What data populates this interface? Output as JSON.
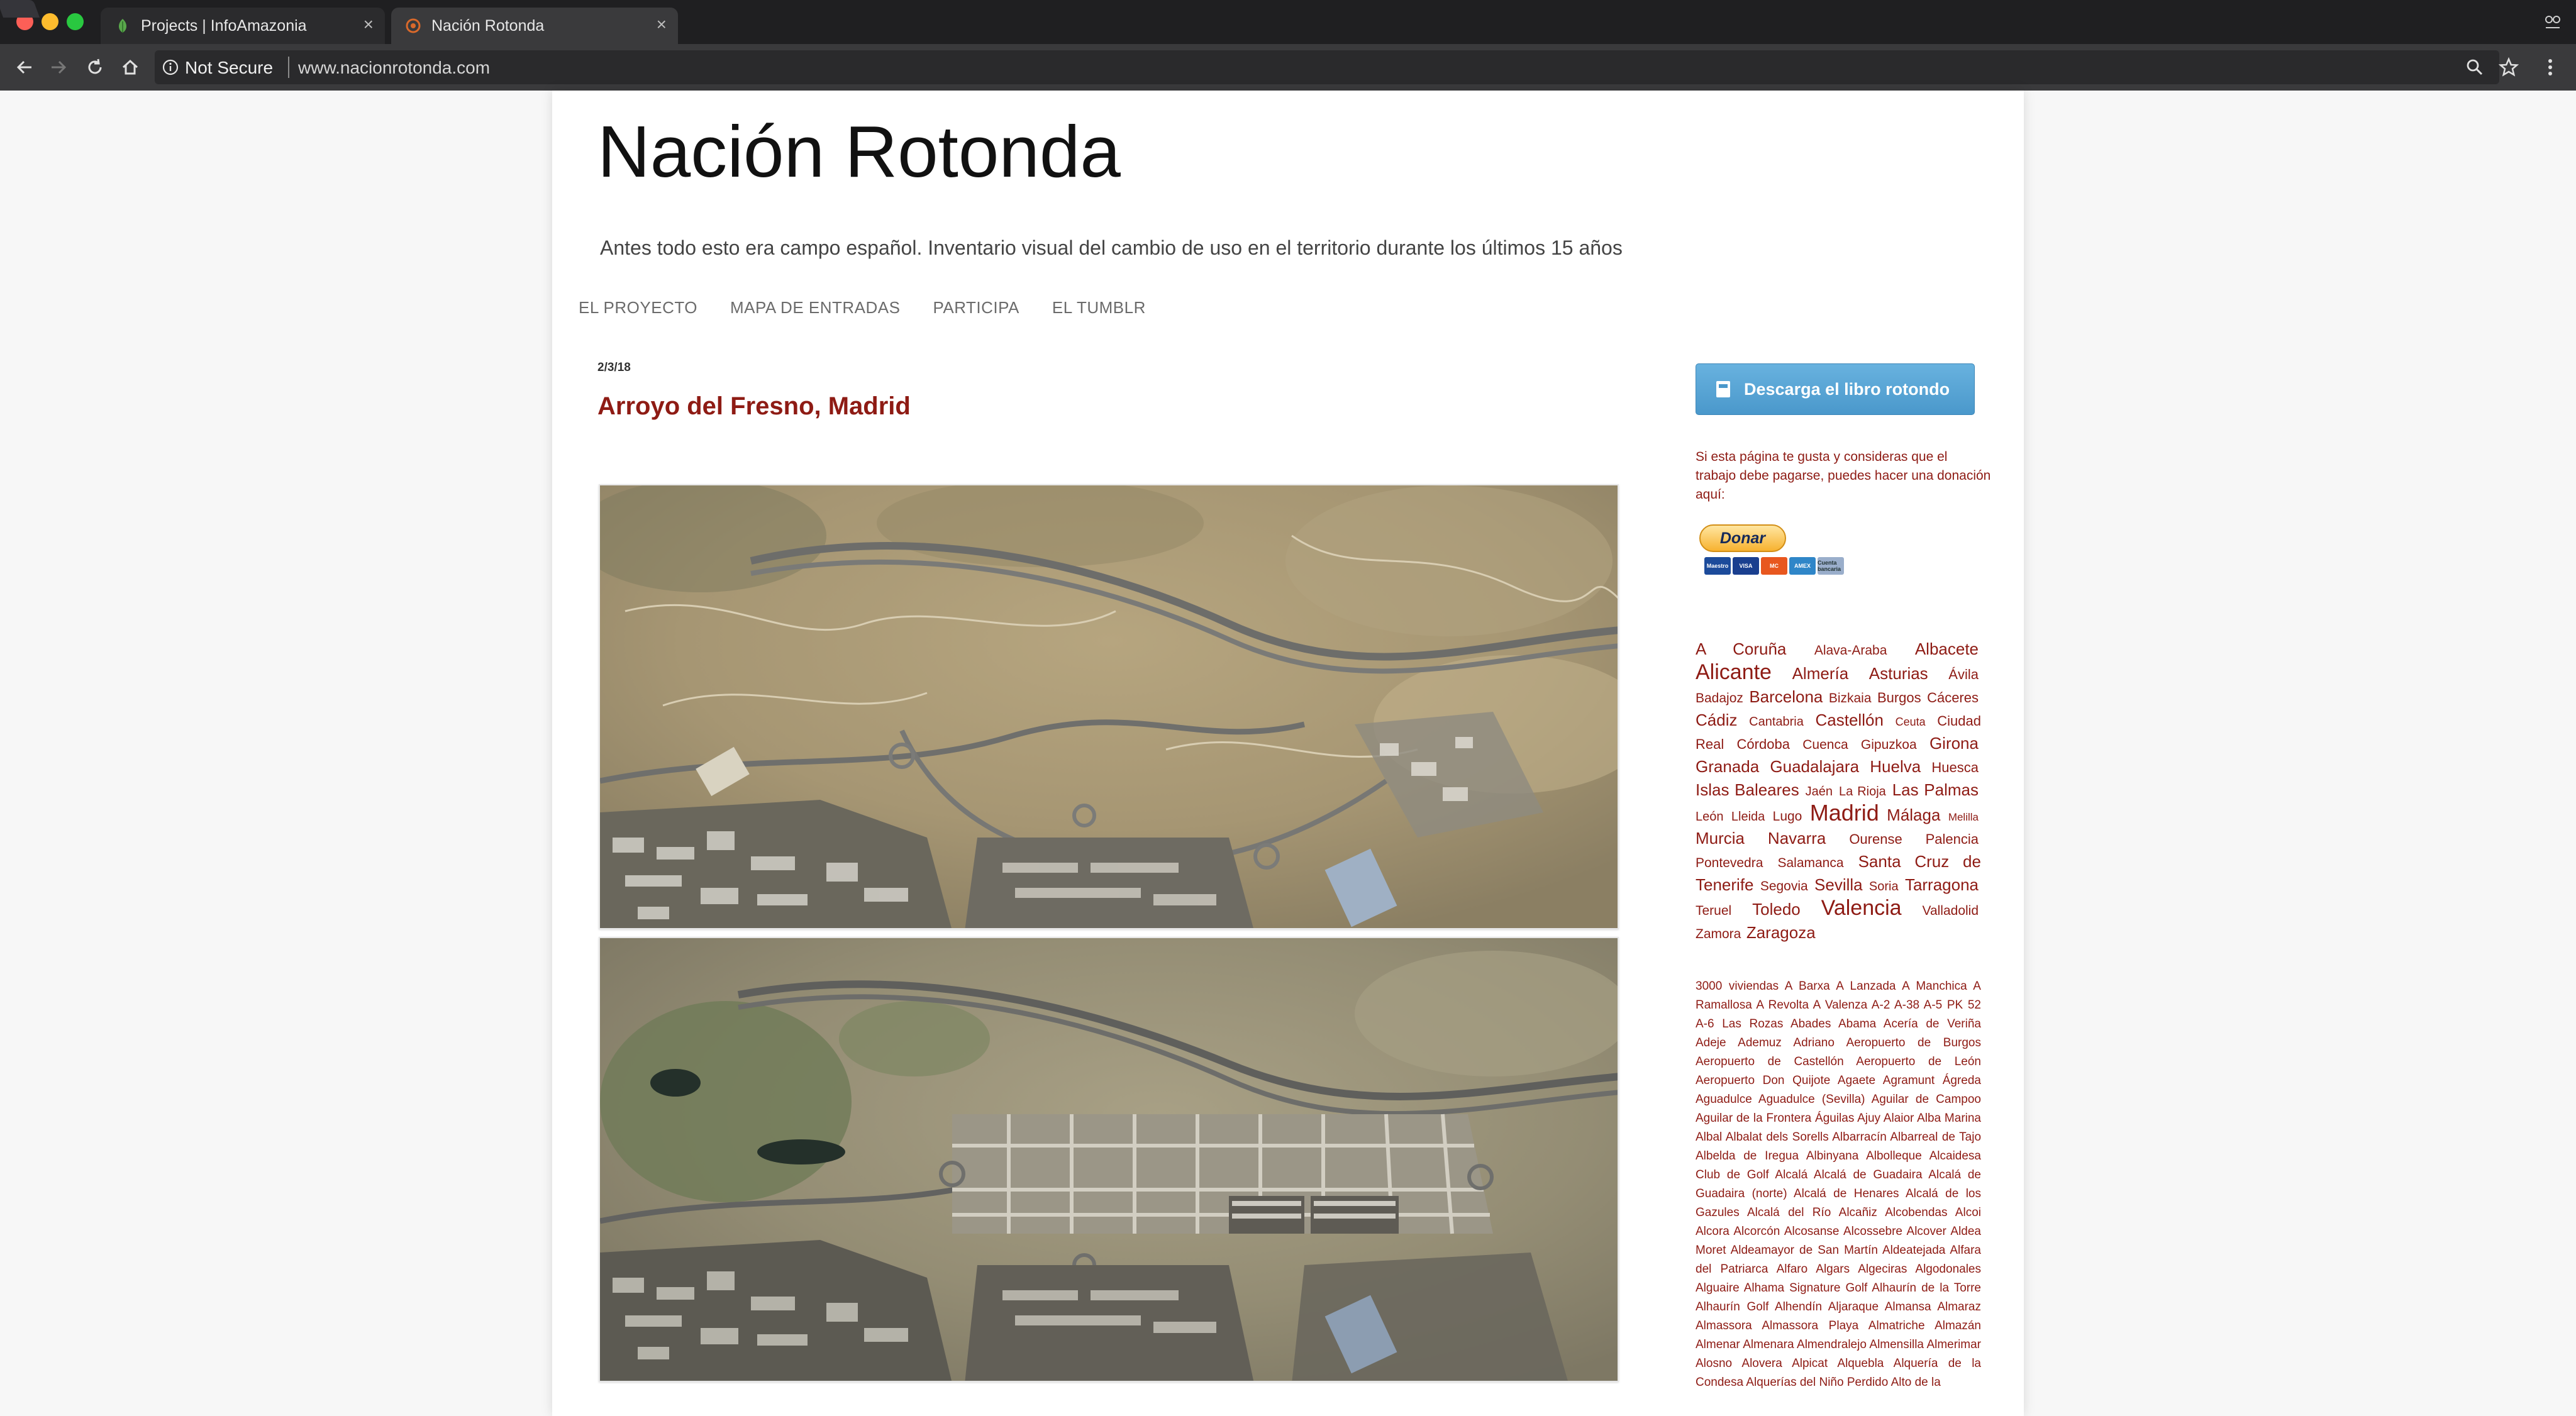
{
  "browser": {
    "tabs": [
      {
        "title": "Projects | InfoAmazonia",
        "active": false
      },
      {
        "title": "Nación Rotonda",
        "active": true
      }
    ],
    "security_label": "Not Secure",
    "url": "www.nacionrotonda.com"
  },
  "blog": {
    "title": "Nación Rotonda",
    "description": "Antes todo esto era campo español. Inventario visual del cambio de uso en el territorio durante los últimos 15 años",
    "nav": [
      "EL PROYECTO",
      "MAPA DE ENTRADAS",
      "PARTICIPA",
      "EL TUMBLR"
    ]
  },
  "post": {
    "date": "2/3/18",
    "title": "Arroyo del Fresno, Madrid"
  },
  "sidebar": {
    "download_label": "Descarga el libro rotondo",
    "donate_text": "Si esta página te gusta y consideras que el trabajo debe pagarse, puedes hacer una donación aquí:",
    "donate_button": "Donar",
    "payment_cards": [
      "Maestro",
      "VISA",
      "MC",
      "AMEX",
      "Cuenta bancaria"
    ],
    "tags": [
      {
        "name": "A Coruña",
        "size": 26
      },
      {
        "name": "Alava-Araba",
        "size": 21
      },
      {
        "name": "Albacete",
        "size": 26
      },
      {
        "name": "Alicante",
        "size": 34
      },
      {
        "name": "Almería",
        "size": 26
      },
      {
        "name": "Asturias",
        "size": 26
      },
      {
        "name": "Ávila",
        "size": 22
      },
      {
        "name": "Badajoz",
        "size": 21
      },
      {
        "name": "Barcelona",
        "size": 26
      },
      {
        "name": "Bizkaia",
        "size": 21
      },
      {
        "name": "Burgos",
        "size": 22
      },
      {
        "name": "Cáceres",
        "size": 22
      },
      {
        "name": "Cádiz",
        "size": 26
      },
      {
        "name": "Cantabria",
        "size": 20
      },
      {
        "name": "Castellón",
        "size": 26
      },
      {
        "name": "Ceuta",
        "size": 18
      },
      {
        "name": "Ciudad Real",
        "size": 22
      },
      {
        "name": "Córdoba",
        "size": 22
      },
      {
        "name": "Cuenca",
        "size": 21
      },
      {
        "name": "Gipuzkoa",
        "size": 21
      },
      {
        "name": "Girona",
        "size": 26
      },
      {
        "name": "Granada",
        "size": 26
      },
      {
        "name": "Guadalajara",
        "size": 26
      },
      {
        "name": "Huelva",
        "size": 26
      },
      {
        "name": "Huesca",
        "size": 22
      },
      {
        "name": "Islas Baleares",
        "size": 26
      },
      {
        "name": "Jaén",
        "size": 20
      },
      {
        "name": "La Rioja",
        "size": 20
      },
      {
        "name": "Las Palmas",
        "size": 26
      },
      {
        "name": "León",
        "size": 20
      },
      {
        "name": "Lleida",
        "size": 20
      },
      {
        "name": "Lugo",
        "size": 21
      },
      {
        "name": "Madrid",
        "size": 36
      },
      {
        "name": "Málaga",
        "size": 26
      },
      {
        "name": "Melilla",
        "size": 17
      },
      {
        "name": "Murcia",
        "size": 26
      },
      {
        "name": "Navarra",
        "size": 26
      },
      {
        "name": "Ourense",
        "size": 22
      },
      {
        "name": "Palencia",
        "size": 22
      },
      {
        "name": "Pontevedra",
        "size": 21
      },
      {
        "name": "Salamanca",
        "size": 21
      },
      {
        "name": "Santa Cruz de Tenerife",
        "size": 26
      },
      {
        "name": "Segovia",
        "size": 21
      },
      {
        "name": "Sevilla",
        "size": 26
      },
      {
        "name": "Soria",
        "size": 20
      },
      {
        "name": "Tarragona",
        "size": 26
      },
      {
        "name": "Teruel",
        "size": 21
      },
      {
        "name": "Toledo",
        "size": 26
      },
      {
        "name": "Valencia",
        "size": 34
      },
      {
        "name": "Valladolid",
        "size": 21
      },
      {
        "name": "Zamora",
        "size": 21
      },
      {
        "name": "Zaragoza",
        "size": 26
      }
    ],
    "labels": [
      "3000 viviendas",
      "A Barxa",
      "A Lanzada",
      "A Manchica",
      "A Ramallosa",
      "A Revolta",
      "A Valenza",
      "A-2",
      "A-38",
      "A-5 PK 52",
      "A-6 Las Rozas",
      "Abades",
      "Abama",
      "Acería de Veriña",
      "Adeje",
      "Ademuz",
      "Adriano",
      "Aeropuerto de Burgos",
      "Aeropuerto de Castellón",
      "Aeropuerto de León",
      "Aeropuerto Don Quijote",
      "Agaete",
      "Agramunt",
      "Ágreda",
      "Aguadulce",
      "Aguadulce (Sevilla)",
      "Aguilar de Campoo",
      "Aguilar de la Frontera",
      "Águilas",
      "Ajuy",
      "Alaior",
      "Alba Marina",
      "Albal",
      "Albalat dels Sorells",
      "Albarracín",
      "Albarreal de Tajo",
      "Albelda de Iregua",
      "Albinyana",
      "Albolleque",
      "Alcaidesa Club de Golf",
      "Alcalá",
      "Alcalá de Guadaira",
      "Alcalá de Guadaira (norte)",
      "Alcalá de Henares",
      "Alcalá de los Gazules",
      "Alcalá del Río",
      "Alcañiz",
      "Alcobendas",
      "Alcoi",
      "Alcora",
      "Alcorcón",
      "Alcosanse",
      "Alcossebre",
      "Alcover",
      "Aldea Moret",
      "Aldeamayor de San Martín",
      "Aldeatejada",
      "Alfara del Patriarca",
      "Alfaro",
      "Algars",
      "Algeciras",
      "Algodonales",
      "Alguaire",
      "Alhama Signature Golf",
      "Alhaurín de la Torre",
      "Alhaurín Golf",
      "Alhendín",
      "Aljaraque",
      "Almansa",
      "Almaraz",
      "Almassora",
      "Almassora Playa",
      "Almatriche",
      "Almazán",
      "Almenar",
      "Almenara",
      "Almendralejo",
      "Almensilla",
      "Almerimar",
      "Alosno",
      "Alovera",
      "Alpicat",
      "Alquebla",
      "Alquería de la Condesa",
      "Alquerías del Niño Perdido",
      "Alto de la"
    ]
  }
}
